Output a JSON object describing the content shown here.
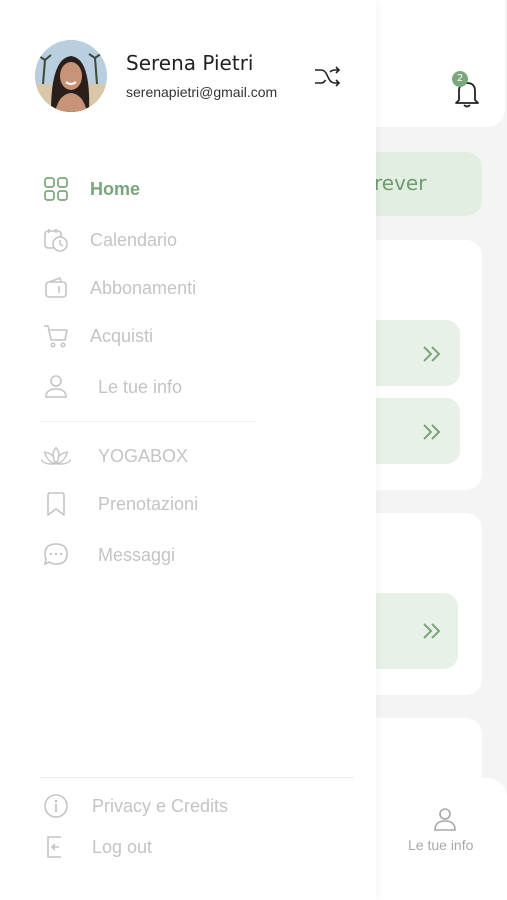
{
  "background": {
    "notification_count": "2",
    "filter_pill_text": "rever",
    "tabbar": {
      "label": "Le tue info"
    }
  },
  "drawer": {
    "user": {
      "name": "Serena Pietri",
      "email": "serenapietri@gmail.com"
    },
    "menu": [
      {
        "label": "Home",
        "icon": "grid-icon",
        "active": true
      },
      {
        "label": "Calendario",
        "icon": "calendar-history-icon"
      },
      {
        "label": "Abbonamenti",
        "icon": "wallet-icon"
      },
      {
        "label": "Acquisti",
        "icon": "cart-icon"
      },
      {
        "label": "Le tue info",
        "icon": "user-icon"
      }
    ],
    "secondary_menu": [
      {
        "label": "YOGABOX",
        "icon": "lotus-icon"
      },
      {
        "label": "Prenotazioni",
        "icon": "bookmark-icon"
      },
      {
        "label": "Messaggi",
        "icon": "chat-icon"
      }
    ],
    "footer_menu": [
      {
        "label": "Privacy e Credits",
        "icon": "info-icon"
      },
      {
        "label": "Log out",
        "icon": "logout-icon"
      }
    ]
  },
  "colors": {
    "accent": "#7aa57c",
    "inactive": "#c4c4c4",
    "pill_bg": "#e3eee3"
  }
}
